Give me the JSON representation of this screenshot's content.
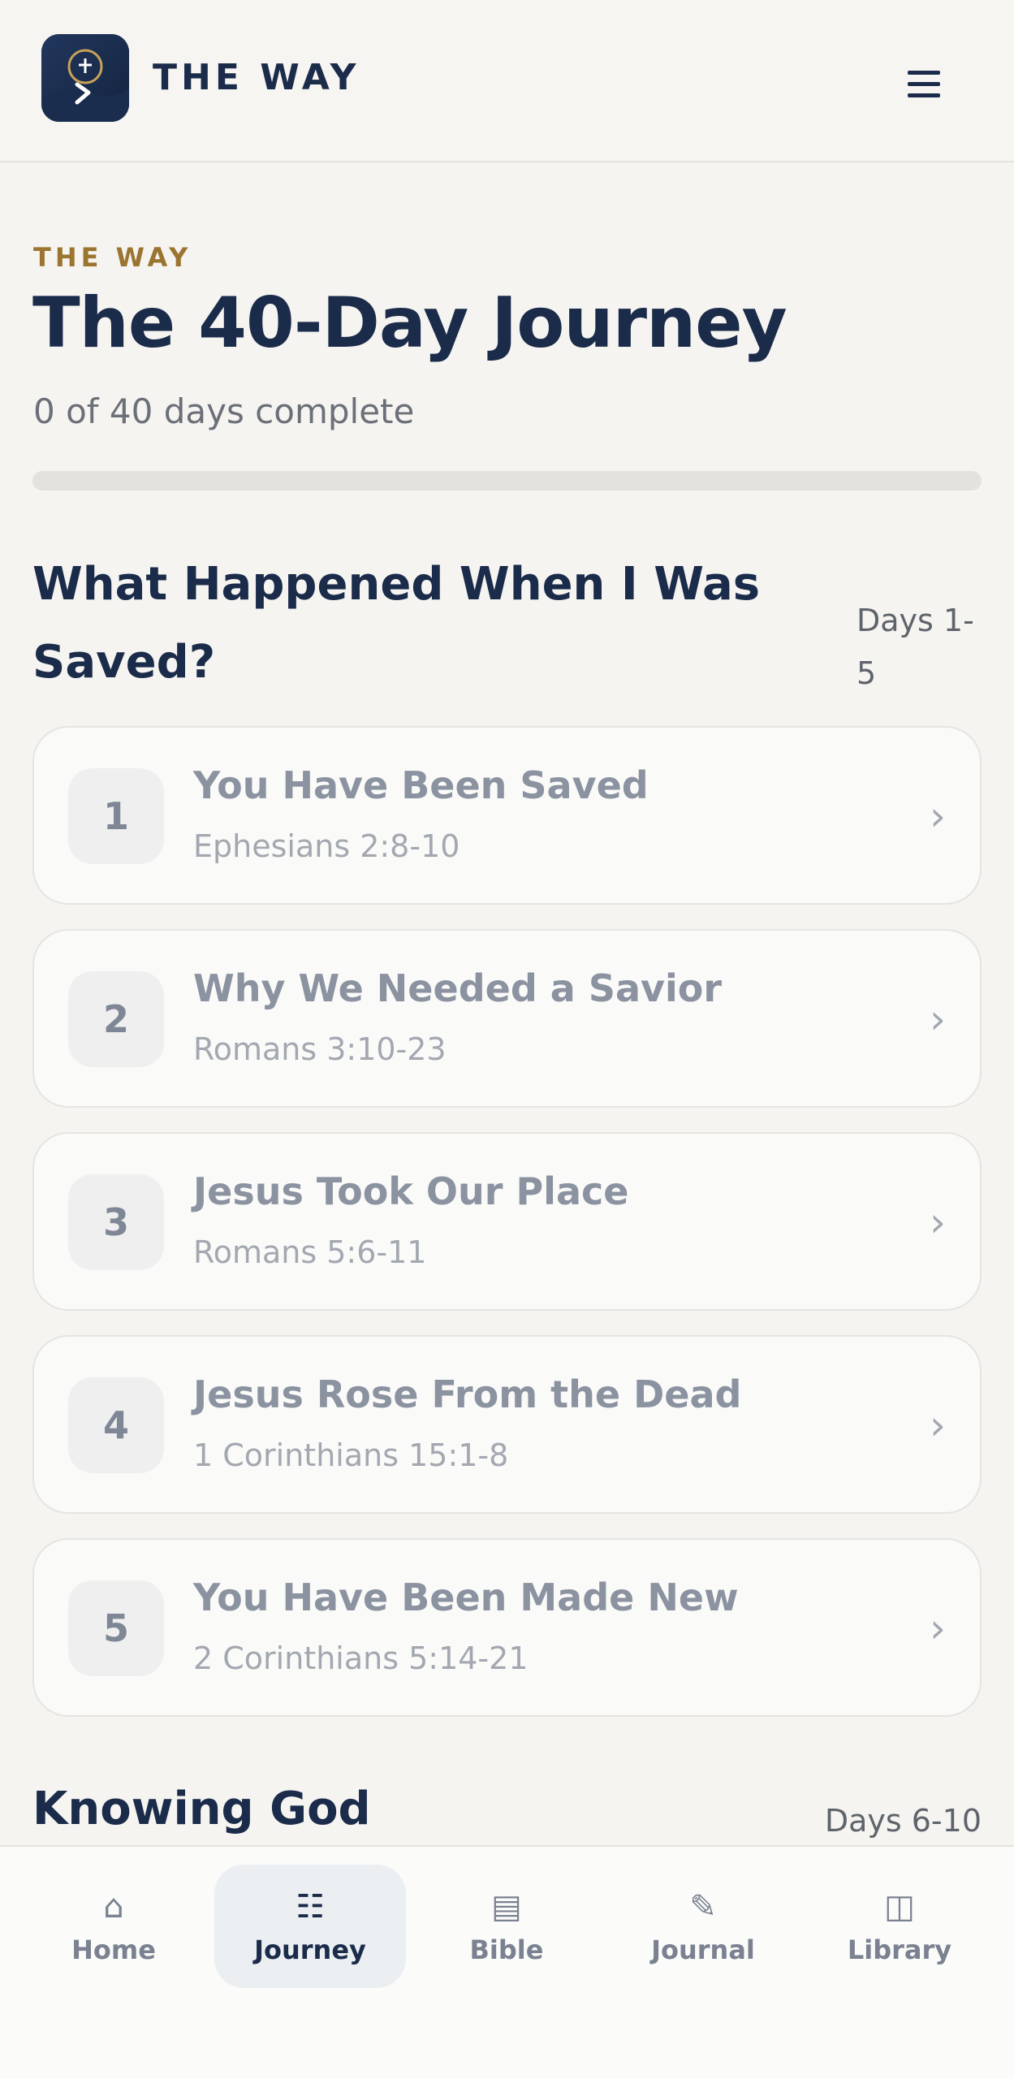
{
  "header": {
    "brand": "THE WAY",
    "logo_icon": "compass-cross-icon",
    "menu_icon": "hamburger-menu-icon"
  },
  "intro": {
    "eyebrow": "THE WAY",
    "title": "The 40-Day Journey",
    "progress_text": "0 of 40 days complete",
    "progress_fraction": 0
  },
  "sections": [
    {
      "title": "What Happened When I Was Saved?",
      "range_line1": "Days 1-",
      "range_line2": "5",
      "days": [
        {
          "number": "1",
          "title": "You Have Been Saved",
          "reference": "Ephesians 2:8-10"
        },
        {
          "number": "2",
          "title": "Why We Needed a Savior",
          "reference": "Romans 3:10-23"
        },
        {
          "number": "3",
          "title": "Jesus Took Our Place",
          "reference": "Romans 5:6-11"
        },
        {
          "number": "4",
          "title": "Jesus Rose From the Dead",
          "reference": "1 Corinthians 15:1-8"
        },
        {
          "number": "5",
          "title": "You Have Been Made New",
          "reference": "2 Corinthians 5:14-21"
        }
      ]
    },
    {
      "title": "Knowing God",
      "range": "Days 6-10"
    }
  ],
  "bottom_nav": [
    {
      "label": "Home",
      "icon": "⌂",
      "icon_name": "home-icon",
      "active": false
    },
    {
      "label": "Journey",
      "icon": "☷",
      "icon_name": "journey-icon",
      "active": true
    },
    {
      "label": "Bible",
      "icon": "▤",
      "icon_name": "bible-icon",
      "active": false
    },
    {
      "label": "Journal",
      "icon": "✎",
      "icon_name": "journal-icon",
      "active": false
    },
    {
      "label": "Library",
      "icon": "◫",
      "icon_name": "library-icon",
      "active": false
    }
  ],
  "colors": {
    "accent_gold": "#9b7430",
    "navy": "#1b2b4a",
    "background": "#f5f4f1"
  }
}
